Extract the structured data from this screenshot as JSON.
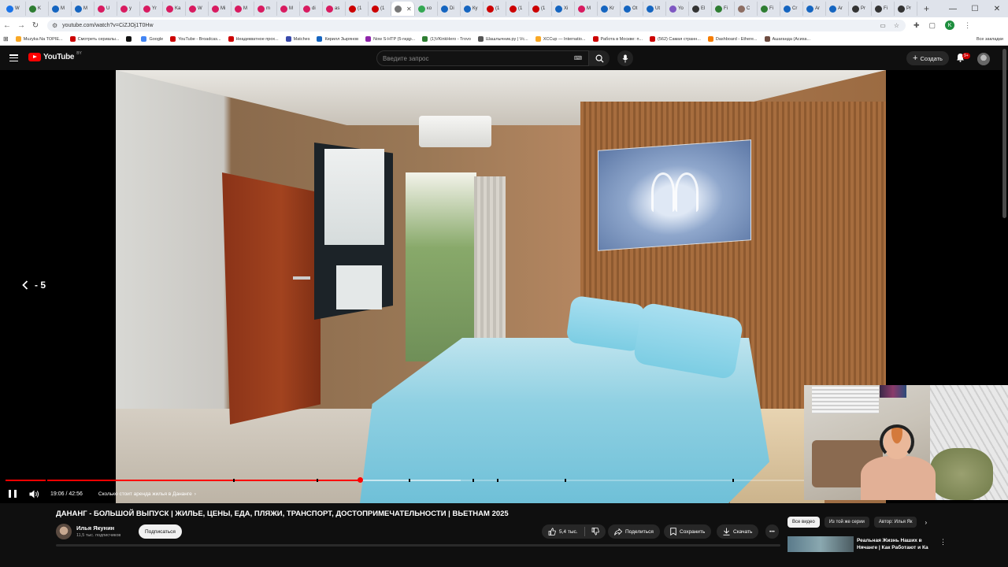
{
  "browser": {
    "tabs": [
      {
        "label": "W",
        "color": "#1a73e8"
      },
      {
        "label": "K",
        "color": "#2e7d32"
      },
      {
        "label": "M",
        "color": "#1565c0"
      },
      {
        "label": "M",
        "color": "#1565c0"
      },
      {
        "label": "U",
        "color": "#d81b60"
      },
      {
        "label": "y",
        "color": "#d81b60"
      },
      {
        "label": "Yr",
        "color": "#d81b60"
      },
      {
        "label": "Ka",
        "color": "#d81b60"
      },
      {
        "label": "W",
        "color": "#d81b60"
      },
      {
        "label": "Mi",
        "color": "#d81b60"
      },
      {
        "label": "M",
        "color": "#d81b60"
      },
      {
        "label": "m",
        "color": "#d81b60"
      },
      {
        "label": "M",
        "color": "#d81b60"
      },
      {
        "label": "di",
        "color": "#d81b60"
      },
      {
        "label": "as",
        "color": "#d81b60"
      },
      {
        "label": "(1",
        "color": "#cc0000"
      },
      {
        "label": "(1",
        "color": "#cc0000"
      },
      {
        "label": "",
        "color": "#777777",
        "active": true
      },
      {
        "label": "ко",
        "color": "#34a853"
      },
      {
        "label": "Di",
        "color": "#1565c0"
      },
      {
        "label": "Ку",
        "color": "#1565c0"
      },
      {
        "label": "(1",
        "color": "#cc0000"
      },
      {
        "label": "(1",
        "color": "#cc0000"
      },
      {
        "label": "(1",
        "color": "#cc0000"
      },
      {
        "label": "Xi",
        "color": "#1565c0"
      },
      {
        "label": "M",
        "color": "#d81b60"
      },
      {
        "label": "Kr",
        "color": "#1565c0"
      },
      {
        "label": "Ot",
        "color": "#1565c0"
      },
      {
        "label": "Ut",
        "color": "#1565c0"
      },
      {
        "label": "Yo",
        "color": "#7e57c2"
      },
      {
        "label": "El",
        "color": "#333333"
      },
      {
        "label": "Fi",
        "color": "#2e7d32"
      },
      {
        "label": "C",
        "color": "#8d6e63"
      },
      {
        "label": "Fi",
        "color": "#2e7d32"
      },
      {
        "label": "Cr",
        "color": "#1565c0"
      },
      {
        "label": "Ar",
        "color": "#1565c0"
      },
      {
        "label": "Ar",
        "color": "#1565c0"
      },
      {
        "label": "Pr",
        "color": "#333333"
      },
      {
        "label": "Fi",
        "color": "#333333"
      },
      {
        "label": "Pr",
        "color": "#333333"
      }
    ],
    "url": "youtube.com/watch?v=CiZJOj1T0Hw",
    "bookmarks": [
      {
        "label": "Muzyka Na TOPIE...",
        "color": "#f9a825"
      },
      {
        "label": "Смотреть сериалы...",
        "color": "#cc0000"
      },
      {
        "label": "",
        "color": "#111111"
      },
      {
        "label": "Google",
        "color": "#4285f4"
      },
      {
        "label": "YouTube - Broadcas...",
        "color": "#cc0000"
      },
      {
        "label": "Неадекватное прох...",
        "color": "#cc0000"
      },
      {
        "label": "Matches",
        "color": "#3949ab"
      },
      {
        "label": "Кирилл Зырянов",
        "color": "#1565c0"
      },
      {
        "label": "Now S-HTP (5-гидр...",
        "color": "#8e24aa"
      },
      {
        "label": "(1)VKinkHero - Trovo",
        "color": "#2e7d32"
      },
      {
        "label": "Шашлычник.ру | Vc...",
        "color": "#555555"
      },
      {
        "label": "XCCup — Internatio...",
        "color": "#f9a825"
      },
      {
        "label": "Работа в Москве: п...",
        "color": "#cc0000"
      },
      {
        "label": "(562) Самая странн...",
        "color": "#cc0000"
      },
      {
        "label": "Dashboard - Ethere...",
        "color": "#f57c00"
      },
      {
        "label": "Ашаганда (Асиха...",
        "color": "#6d4c41"
      }
    ],
    "all_bookmarks": "Все закладки"
  },
  "youtube": {
    "logo_text": "YouTube",
    "region": "BY",
    "search_placeholder": "Введите запрос",
    "create_label": "Создать",
    "notifications_badge": "9+",
    "player": {
      "seek_text": "- 5",
      "time_current": "19:06",
      "time_total": "42:56",
      "time_display": "19:06 / 42:56",
      "played_fraction": 0.4445,
      "buffered_fraction": 0.57,
      "chapter_title": "Сколько стоит аренда жилья в Дананге",
      "chapter_marks": [
        0.05,
        0.285,
        0.39,
        0.505,
        0.585,
        0.615,
        0.7,
        0.91
      ]
    },
    "video_title": "ДАНАНГ - БОЛЬШОЙ ВЫПУСК | ЖИЛЬЕ, ЦЕНЫ, ЕДА, ПЛЯЖИ, ТРАНСПОРТ, ДОСТОПРИМЕЧАТЕЛЬНОСТИ | ВЬЕТНАМ 2025",
    "channel": {
      "name": "Илья Якунин",
      "subscribers": "11,5 тыс. подписчиков",
      "subscribe_label": "Подписаться"
    },
    "actions": {
      "likes": "5,4 тыс.",
      "share": "Поделиться",
      "save": "Сохранить",
      "download": "Скачать"
    },
    "chips": [
      "Все видео",
      "Из той же серии",
      "Автор: Илья Як"
    ],
    "recommendation": {
      "title": "Реальная Жизнь Наших в Нячанге | Как Работают и Ка"
    }
  }
}
